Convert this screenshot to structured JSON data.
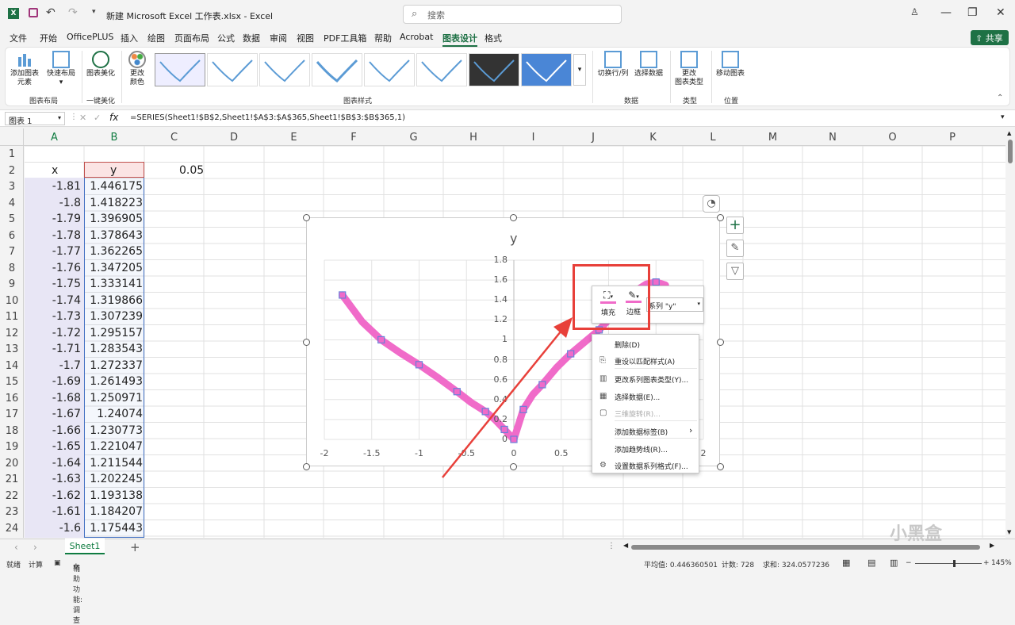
{
  "title": {
    "filename": "新建 Microsoft Excel 工作表.xlsx",
    "app": "Excel",
    "search_placeholder": "搜索"
  },
  "menu": {
    "items": [
      "文件",
      "开始",
      "OfficePLUS",
      "插入",
      "绘图",
      "页面布局",
      "公式",
      "数据",
      "审阅",
      "视图",
      "PDF工具箱",
      "帮助",
      "Acrobat",
      "图表设计",
      "格式"
    ],
    "active": "图表设计",
    "share": "共享"
  },
  "ribbon": {
    "add_element": "添加图表\n元素",
    "quick_layout": "快速布局",
    "chart_beautify": "图表美化",
    "change_color": "更改\n颜色",
    "switch_row_col": "切换行/列",
    "select_data": "选择数据",
    "change_type": "更改\n图表类型",
    "move_chart": "移动图表",
    "groups": {
      "layout": "图表布局",
      "beautify": "一键美化",
      "styles": "图表样式",
      "data": "数据",
      "type": "类型",
      "location": "位置"
    }
  },
  "formula_bar": {
    "name_box": "图表 1",
    "fx": "fx",
    "formula": "=SERIES(Sheet1!$B$2,Sheet1!$A$3:$A$365,Sheet1!$B$3:$B$365,1)"
  },
  "columns": [
    "A",
    "B",
    "C",
    "D",
    "E",
    "F",
    "G",
    "H",
    "I",
    "J",
    "K",
    "L",
    "M",
    "N",
    "O",
    "P"
  ],
  "rows": [
    "1",
    "2",
    "3",
    "4",
    "5",
    "6",
    "7",
    "8",
    "9",
    "10",
    "11",
    "12",
    "13",
    "14",
    "15",
    "16",
    "17",
    "18",
    "19",
    "20",
    "21",
    "22",
    "23",
    "24"
  ],
  "cells": {
    "A2": "x",
    "B2": "y",
    "C2": "0.05",
    "A": [
      "-1.81",
      "-1.8",
      "-1.79",
      "-1.78",
      "-1.77",
      "-1.76",
      "-1.75",
      "-1.74",
      "-1.73",
      "-1.72",
      "-1.71",
      "-1.7",
      "-1.69",
      "-1.68",
      "-1.67",
      "-1.66",
      "-1.65",
      "-1.64",
      "-1.63",
      "-1.62",
      "-1.61",
      "-1.6"
    ],
    "B": [
      "1.446175",
      "1.418223",
      "1.396905",
      "1.378643",
      "1.362265",
      "1.347205",
      "1.333141",
      "1.319866",
      "1.307239",
      "1.295157",
      "1.283543",
      "1.272337",
      "1.261493",
      "1.250971",
      "1.24074",
      "1.230773",
      "1.221047",
      "1.211544",
      "1.202245",
      "1.193138",
      "1.184207",
      "1.175443"
    ]
  },
  "chart_data": {
    "type": "scatter",
    "title": "y",
    "xlim": [
      -2,
      2
    ],
    "ylim": [
      0,
      1.8
    ],
    "xticks": [
      "-2",
      "-1.5",
      "-1",
      "-0.5",
      "0",
      "0.5",
      "1",
      "1.5",
      "2"
    ],
    "yticks": [
      "0",
      "0.2",
      "0.4",
      "0.6",
      "0.8",
      "1",
      "1.2",
      "1.4",
      "1.6",
      "1.8"
    ],
    "series": [
      {
        "name": "y",
        "color": "#f06bc9",
        "x": [
          -1.81,
          -1.6,
          -1.4,
          -1.2,
          -1.0,
          -0.8,
          -0.6,
          -0.45,
          -0.3,
          -0.2,
          -0.1,
          0,
          0.1,
          0.2,
          0.3,
          0.45,
          0.6,
          0.75,
          0.9,
          1.0,
          1.1,
          1.2,
          1.3,
          1.4,
          1.5,
          1.6
        ],
        "y": [
          1.45,
          1.18,
          1.0,
          0.87,
          0.75,
          0.62,
          0.48,
          0.37,
          0.28,
          0.2,
          0.1,
          0.0,
          0.3,
          0.45,
          0.55,
          0.72,
          0.86,
          0.98,
          1.1,
          1.2,
          1.32,
          1.42,
          1.5,
          1.56,
          1.58,
          1.55
        ]
      }
    ]
  },
  "mini_toolbar": {
    "fill": "填充",
    "border": "边框",
    "series_select": "系列 \"y\""
  },
  "context_menu": [
    "删除(D)",
    "重设以匹配样式(A)",
    "更改系列图表类型(Y)...",
    "选择数据(E)...",
    "三维旋转(R)...",
    "添加数据标签(B)",
    "添加趋势线(R)...",
    "设置数据系列格式(F)..."
  ],
  "sheet_tab": "Sheet1",
  "status": {
    "ready": "就绪",
    "calc": "计算",
    "accessibility": "辅助功能: 调查",
    "average": "平均值: 0.446360501",
    "count": "计数: 728",
    "sum": "求和: 324.0577236",
    "zoom": "145%"
  },
  "watermark": "小黑盒"
}
